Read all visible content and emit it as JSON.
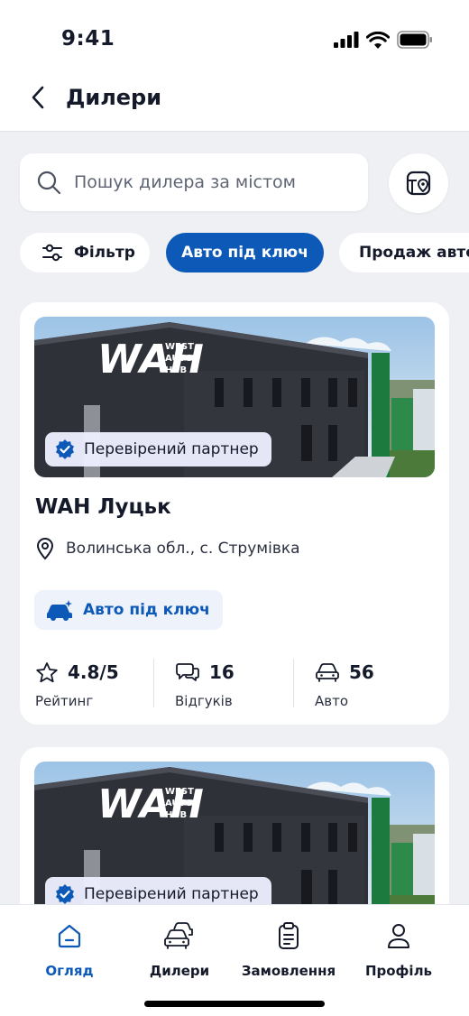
{
  "status_bar": {
    "time": "9:41"
  },
  "header": {
    "title": "Дилери"
  },
  "search": {
    "placeholder": "Пошук дилера за містом"
  },
  "filters": {
    "filter_label": "Фільтр",
    "chips": [
      "Авто під ключ",
      "Продаж авто"
    ],
    "active_chip": "Авто під ключ"
  },
  "dealers": [
    {
      "verified_label": "Перевірений партнер",
      "photo_sign": [
        "WEST",
        "AUTO",
        "HUB"
      ],
      "name": "WAH Луцьк",
      "address": "Волинська обл., с. Струмівка",
      "service_tag": "Авто під ключ",
      "rating": "4.8/5",
      "rating_label": "Рейтинг",
      "reviews": "16",
      "reviews_label": "Відгуків",
      "cars": "56",
      "cars_label": "Авто"
    },
    {
      "verified_label": "Перевірений партнер",
      "photo_sign": [
        "WEST",
        "AUTO",
        "HUB"
      ]
    }
  ],
  "tabbar": {
    "items": [
      {
        "label": "Огляд",
        "icon": "home-icon",
        "active": true
      },
      {
        "label": "Дилери",
        "icon": "dealers-cars-icon",
        "active": false
      },
      {
        "label": "Замовлення",
        "icon": "orders-clipboard-icon",
        "active": false
      },
      {
        "label": "Профіль",
        "icon": "profile-icon",
        "active": false
      }
    ]
  },
  "colors": {
    "accent": "#0d59b8",
    "background": "#eef0f4",
    "card": "#ffffff",
    "text": "#141a2a"
  }
}
